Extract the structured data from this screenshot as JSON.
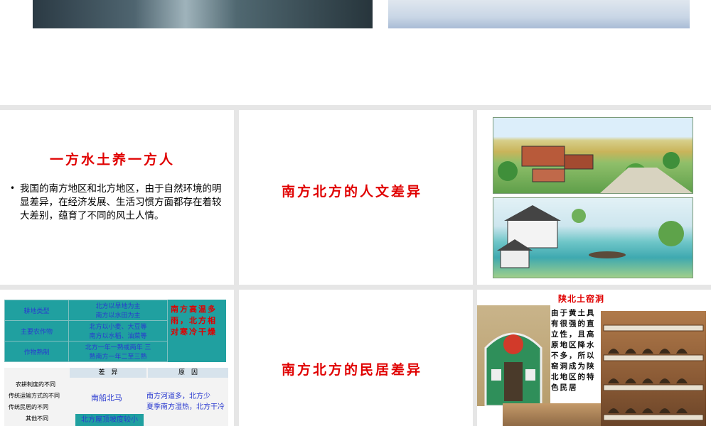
{
  "slide1": {
    "title": "一方水土养一方人",
    "bullet": "我国的南方地区和北方地区，由于自然环境的明显差异，在经济发展、生活习惯方面都存在着较大差别，蕴育了不同的风土人情。"
  },
  "slide2": {
    "title": "南方北方的人文差异"
  },
  "slide4": {
    "table1": [
      {
        "label": "耕地类型",
        "value": "北方以旱地为主\n南方以水田为主"
      },
      {
        "label": "主要农作物",
        "value": "北方以小麦、大豆等\n南方以水稻、油菜等"
      },
      {
        "label": "作物熟制",
        "value": "北方一年一熟或两年 三\n熟南方一年二至三熟"
      }
    ],
    "side_note": "南方高温多雨，北方相对寒冷干燥",
    "table2_headers": [
      "差　异",
      "原　因"
    ],
    "table2_rows": [
      "农耕制度的不同",
      "传统运输方式的不同",
      "传统民居的不同",
      "其他不同"
    ],
    "transport": "南船北马",
    "reason": "南方河道多，北方少\n夏季南方湿热，北方干冷",
    "roof": "北方屋顶坡度较小"
  },
  "slide5": {
    "title": "南方北方的民居差异"
  },
  "slide6": {
    "title": "陕北土窑洞",
    "text": "由于黄土具有很强的直立性，且高原地区降水不多，所以窑洞成为陕北地区的特色民居"
  },
  "colors": {
    "title_red": "#e00000",
    "table_teal": "#20a0a0",
    "text_blue": "#2a3ad0"
  }
}
